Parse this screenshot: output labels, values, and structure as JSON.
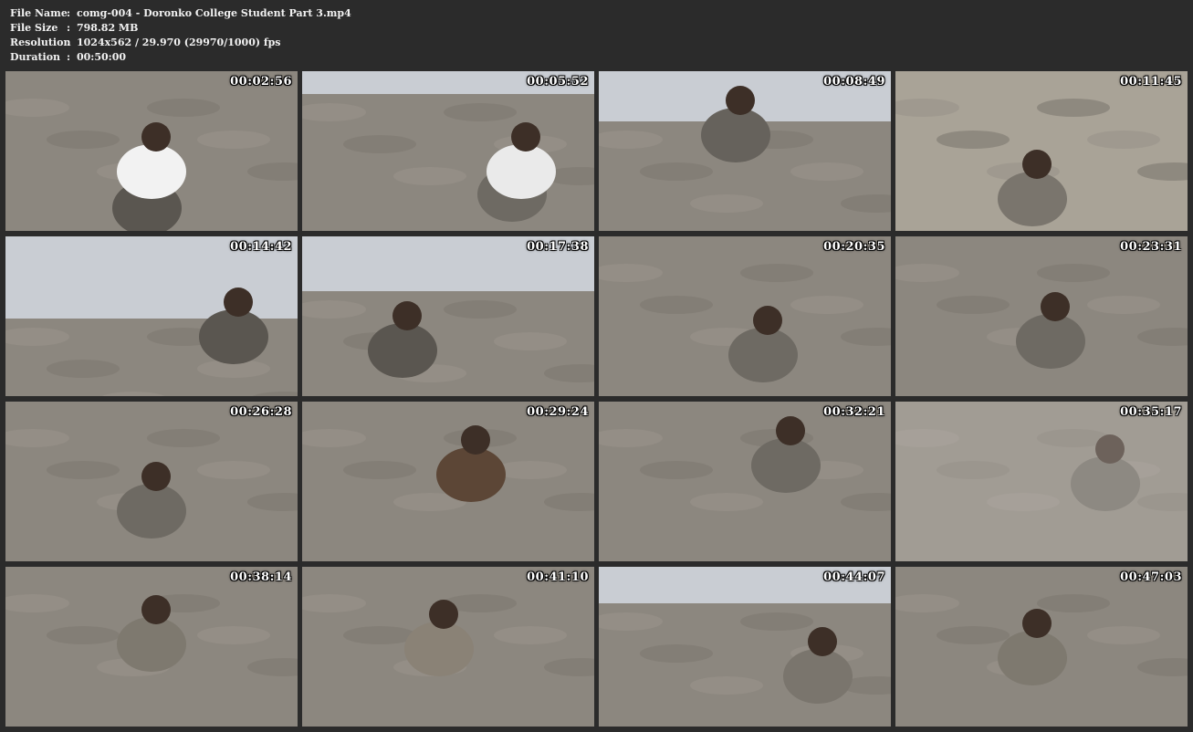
{
  "info": {
    "rows": [
      {
        "key": "File Name",
        "sep": ":",
        "value": "comg-004 - Doronko College Student Part 3.mp4"
      },
      {
        "key": "File Size",
        "sep": ":",
        "value": "798.82 MB"
      },
      {
        "key": "Resolution",
        "sep": ":",
        "value": "1024x562 / 29.970 (29970/1000) fps"
      },
      {
        "key": "Duration",
        "sep": ":",
        "value": "00:50:00"
      }
    ]
  },
  "thumbnails": [
    {
      "timestamp": "00:02:56"
    },
    {
      "timestamp": "00:05:52"
    },
    {
      "timestamp": "00:08:49"
    },
    {
      "timestamp": "00:11:45"
    },
    {
      "timestamp": "00:14:42"
    },
    {
      "timestamp": "00:17:38"
    },
    {
      "timestamp": "00:20:35"
    },
    {
      "timestamp": "00:23:31"
    },
    {
      "timestamp": "00:26:28"
    },
    {
      "timestamp": "00:29:24"
    },
    {
      "timestamp": "00:32:21"
    },
    {
      "timestamp": "00:35:17"
    },
    {
      "timestamp": "00:38:14"
    },
    {
      "timestamp": "00:41:10"
    },
    {
      "timestamp": "00:44:07"
    },
    {
      "timestamp": "00:47:03"
    }
  ],
  "colors": {
    "background": "#2b2b2b",
    "text": "#f2f2f2",
    "mud": "#8c877f",
    "sky": "#c9cdd3"
  }
}
